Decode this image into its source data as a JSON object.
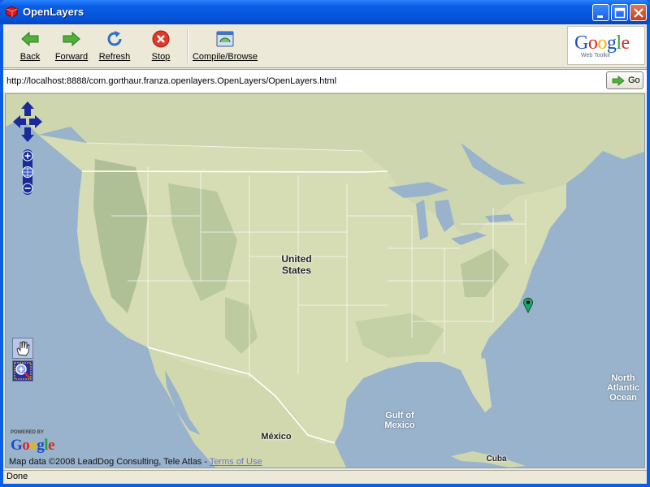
{
  "window": {
    "title": "OpenLayers",
    "controls": {
      "minimize_icon": "minimize-icon",
      "maximize_icon": "maximize-icon",
      "close_icon": "close-icon"
    }
  },
  "toolbar": {
    "buttons": [
      {
        "label": "Back",
        "icon": "back-arrow-icon"
      },
      {
        "label": "Forward",
        "icon": "forward-arrow-icon"
      },
      {
        "label": "Refresh",
        "icon": "refresh-icon"
      },
      {
        "label": "Stop",
        "icon": "stop-icon"
      },
      {
        "label": "Compile/Browse",
        "icon": "compile-browse-icon"
      }
    ],
    "logo": {
      "word": "Google",
      "subtitle": "Web Toolkit"
    }
  },
  "address": {
    "url": "http://localhost:8888/com.gorthaur.franza.openlayers.OpenLayers/OpenLayers.html",
    "go_label": "Go"
  },
  "map": {
    "labels": {
      "country": "United States",
      "country_line1": "United",
      "country_line2": "States",
      "gulf_line1": "Gulf of",
      "gulf_line2": "Mexico",
      "ocean_line1": "North",
      "ocean_line2": "Atlantic",
      "ocean_line3": "Ocean",
      "mexico": "México",
      "cuba": "Cuba"
    },
    "powered_by": "POWERED BY",
    "powered_logo": "Google",
    "attribution": "Map data ©2008 LeadDog Consulting, Tele Atlas - ",
    "terms_link": "Terms of Use",
    "colors": {
      "water": "#99b3cc",
      "land": "#d6dcb4",
      "mountain": "#9fb48a",
      "border": "#ffffff",
      "marker": "#1ea36a"
    }
  },
  "status": {
    "text": "Done"
  }
}
